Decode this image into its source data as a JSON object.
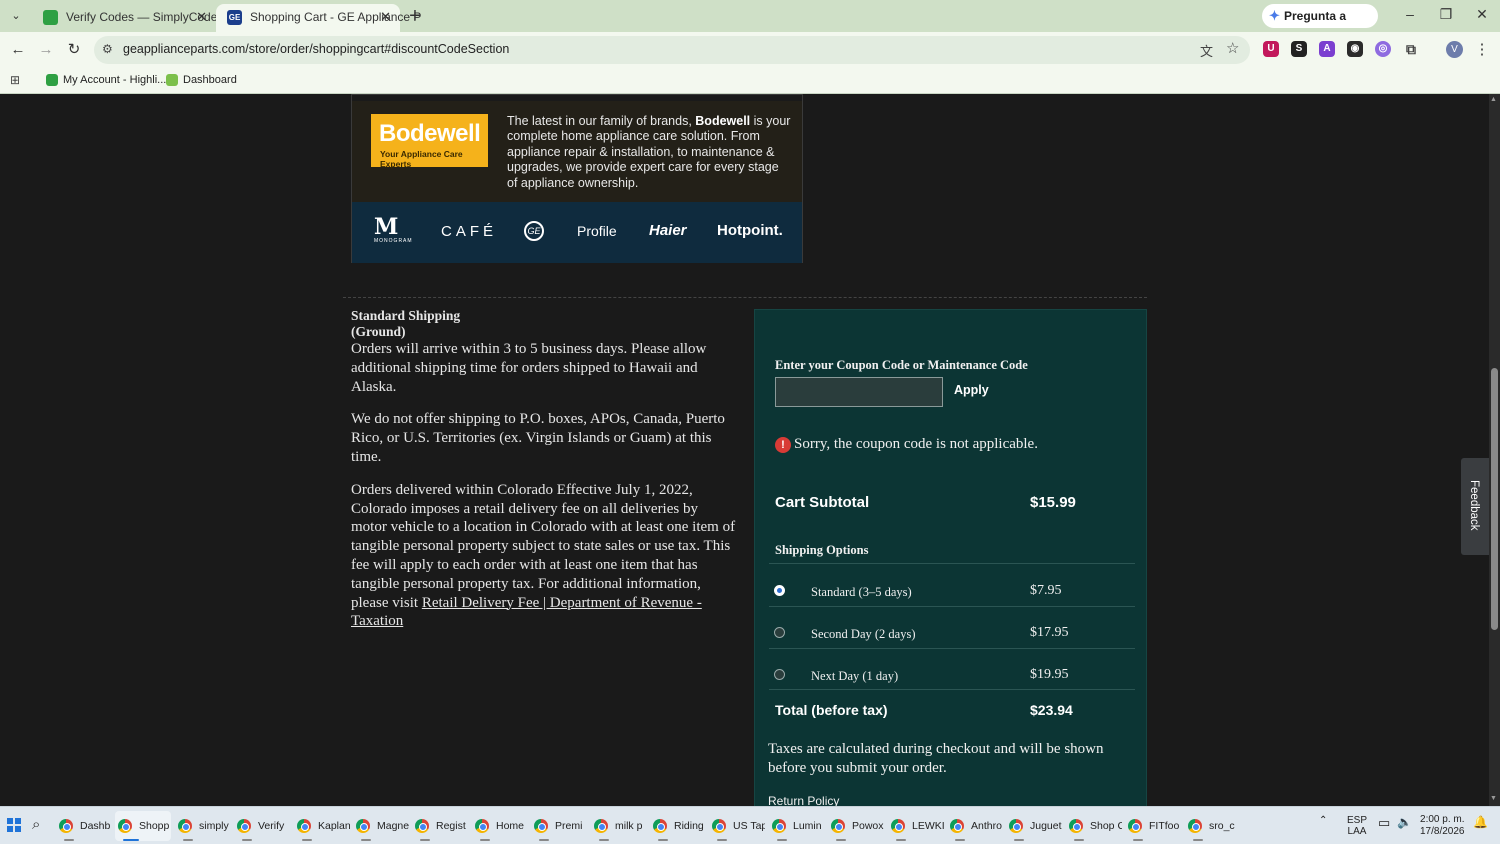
{
  "browser": {
    "tabs": [
      {
        "title": "Verify Codes — SimplyCodes",
        "favicon_color": "#2ea043"
      },
      {
        "title": "Shopping Cart - GE Appliance P",
        "favicon_color": "#1b3e8c",
        "favicon_text": "GE"
      }
    ],
    "gemini_label": "Pregunta a Gemini",
    "url": "geapplianceparts.com/store/order/shoppingcart#discountCodeSection",
    "bookmarks": [
      {
        "label": "My Account - Highli...",
        "favicon_color": "#2ea043"
      },
      {
        "label": "Dashboard",
        "favicon_color": "#7cc04b"
      }
    ],
    "avatar_letter": "V"
  },
  "brand_banner": {
    "logo_big": "Bodewell",
    "logo_small": "Your Appliance Care Experts",
    "desc_lead": "The latest in our family of brands, ",
    "desc_brand": "Bodewell",
    "desc_rest": " is your complete home appliance care solution. From appliance repair & installation, to maintenance & upgrades, we provide expert care for every stage of appliance ownership.",
    "logos": {
      "monogram_mark": "M",
      "monogram_word": "MONOGRAM",
      "cafe": "CAFÉ",
      "ge": "GE",
      "profile": "Profile",
      "haier": "Haier",
      "hotpoint": "Hotpoint."
    }
  },
  "shipping_info": {
    "heading": "Standard Shipping (Ground)",
    "p1": "Orders will arrive within 3 to 5 business days. Please allow additional shipping time for orders shipped to Hawaii and Alaska.",
    "p2": "We do not offer shipping to P.O. boxes, APOs, Canada, Puerto Rico, or U.S. Territories (ex. Virgin Islands or Guam) at this time.",
    "p3": "Orders delivered within Colorado Effective July 1, 2022, Colorado imposes a retail delivery fee on all deliveries by motor vehicle to a location in Colorado with at least one item of tangible personal property subject to state sales or use tax. This fee will apply to each order with at least one item that has tangible personal property tax. For additional information, please visit ",
    "p3_link": "Retail Delivery Fee | Department of Revenue - Taxation"
  },
  "summary": {
    "coupon_label": "Enter your Coupon Code or Maintenance Code",
    "coupon_value": "",
    "apply_label": "Apply",
    "error_text": "Sorry, the coupon code is not applicable.",
    "subtotal_label": "Cart Subtotal",
    "subtotal_value": "$15.99",
    "shipping_label": "Shipping Options",
    "shipping_options": [
      {
        "name": "Standard (3–5 days)",
        "price": "$7.95",
        "selected": true
      },
      {
        "name": "Second Day (2 days)",
        "price": "$17.95",
        "selected": false
      },
      {
        "name": "Next Day (1 day)",
        "price": "$19.95",
        "selected": false
      }
    ],
    "total_label": "Total (before tax)",
    "total_value": "$23.94",
    "tax_note": "Taxes are calculated during checkout and will be shown before you submit your order.",
    "return_policy": "Return Policy"
  },
  "feedback_label": "Feedback",
  "taskbar": {
    "items": [
      "Dashb",
      "Shopp",
      "simply",
      "Verify",
      "Kaplan",
      "Magne",
      "Regist",
      "Home",
      "Premi",
      "milk p",
      "Riding",
      "US Tap",
      "Lumin",
      "Powox",
      "LEWKII",
      "Anthro",
      "Juguet",
      "Shop C",
      "FITfoo",
      "sro_c"
    ],
    "active_index": 1,
    "lang": "ESP",
    "region": "LAA",
    "time": "2:00 p. m.",
    "date": "17/8/2026"
  }
}
